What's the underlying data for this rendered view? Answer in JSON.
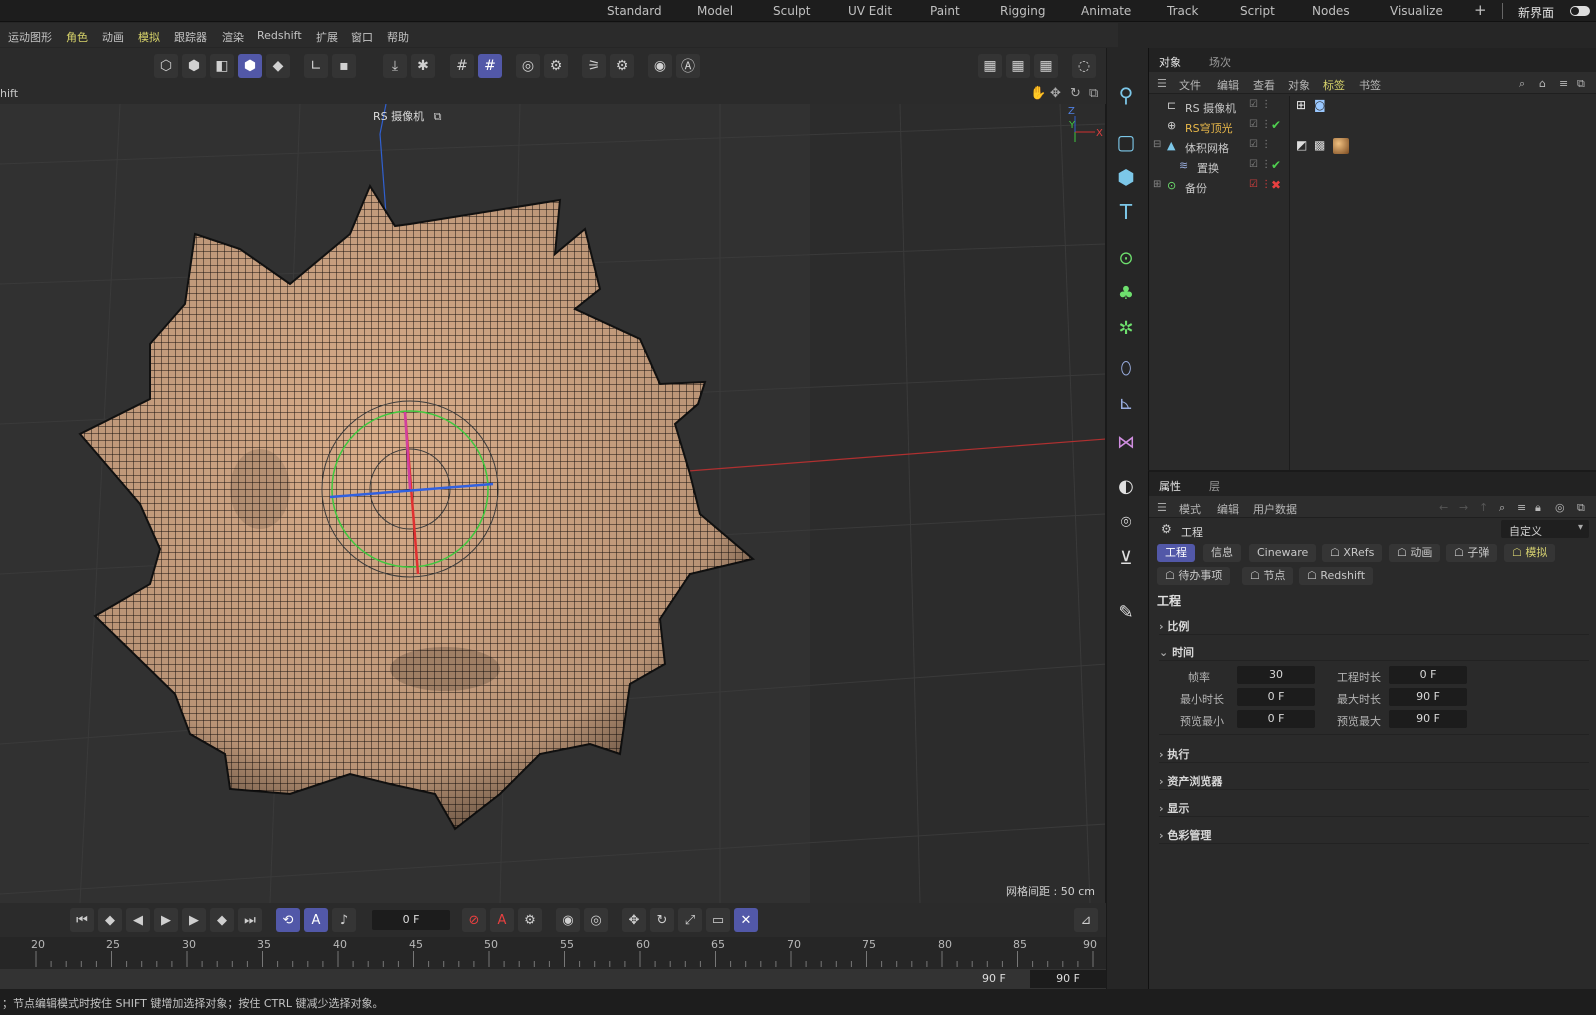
{
  "workspaces": [
    "Standard",
    "Model",
    "Sculpt",
    "UV Edit",
    "Paint",
    "Rigging",
    "Animate",
    "Track",
    "Script",
    "Nodes",
    "Visualize"
  ],
  "workspace_plus": "+",
  "new_layout": "新界面",
  "menu": [
    "运动图形",
    "角色",
    "动画",
    "模拟",
    "跟踪器",
    "渲染",
    "Redshift",
    "扩展",
    "窗口",
    "帮助"
  ],
  "view_header_left": "hift",
  "viewport": {
    "camera_label": "RS 摄像机",
    "grid_spacing": "网格间距 : 50 cm",
    "axis": {
      "z": "Z",
      "y": "Y",
      "x": "X"
    }
  },
  "object_manager": {
    "tabs": [
      "对象",
      "场次"
    ],
    "menu": [
      "文件",
      "编辑",
      "查看",
      "对象",
      "标签",
      "书签"
    ],
    "objects": [
      {
        "name": "RS 摄像机",
        "status": "",
        "color": "#c8c8c8"
      },
      {
        "name": "RS穹顶光",
        "status": "✔",
        "color": "#e8b84a"
      },
      {
        "name": "体积网格",
        "status": "",
        "color": "#c8c8c8"
      },
      {
        "name": "置换",
        "status": "✔",
        "color": "#c8c8c8"
      },
      {
        "name": "备份",
        "status": "✖",
        "color": "#c8c8c8"
      }
    ]
  },
  "attributes": {
    "tabs": [
      "属性",
      "层"
    ],
    "menu": [
      "模式",
      "编辑",
      "用户数据"
    ],
    "object": "工程",
    "preset": "自定义",
    "ptabs_row1": [
      "工程",
      "信息",
      "Cineware",
      "XRefs",
      "动画",
      "子弹",
      "模拟"
    ],
    "ptabs_row2": [
      "待办事项",
      "节点",
      "Redshift"
    ],
    "title": "工程",
    "sections": [
      "比例",
      "时间",
      "执行",
      "资产浏览器",
      "显示",
      "色彩管理"
    ],
    "fields": {
      "fps_label": "帧率",
      "fps": "30",
      "proj_len_label": "工程时长",
      "proj_len": "0 F",
      "min_label": "最小时长",
      "min": "0 F",
      "max_label": "最大时长",
      "max": "90 F",
      "pmin_label": "预览最小",
      "pmin": "0 F",
      "pmax_label": "预览最大",
      "pmax": "90 F"
    }
  },
  "transport": {
    "frame": "0 F"
  },
  "timeline": {
    "ticks": [
      "20",
      "25",
      "30",
      "35",
      "40",
      "45",
      "50",
      "55",
      "60",
      "65",
      "70",
      "75",
      "80",
      "85",
      "90"
    ]
  },
  "range": {
    "end_a": "90 F",
    "end_b": "90 F"
  },
  "status": "；节点编辑模式时按住 SHIFT 键增加选择对象；按住 CTRL 键减少选择对象。",
  "colors": {
    "accent": "#5258a8",
    "mesh": "#d9ad8a",
    "highlight": "#e8b84a",
    "ok": "#4fcf4f",
    "err": "#e84040"
  }
}
